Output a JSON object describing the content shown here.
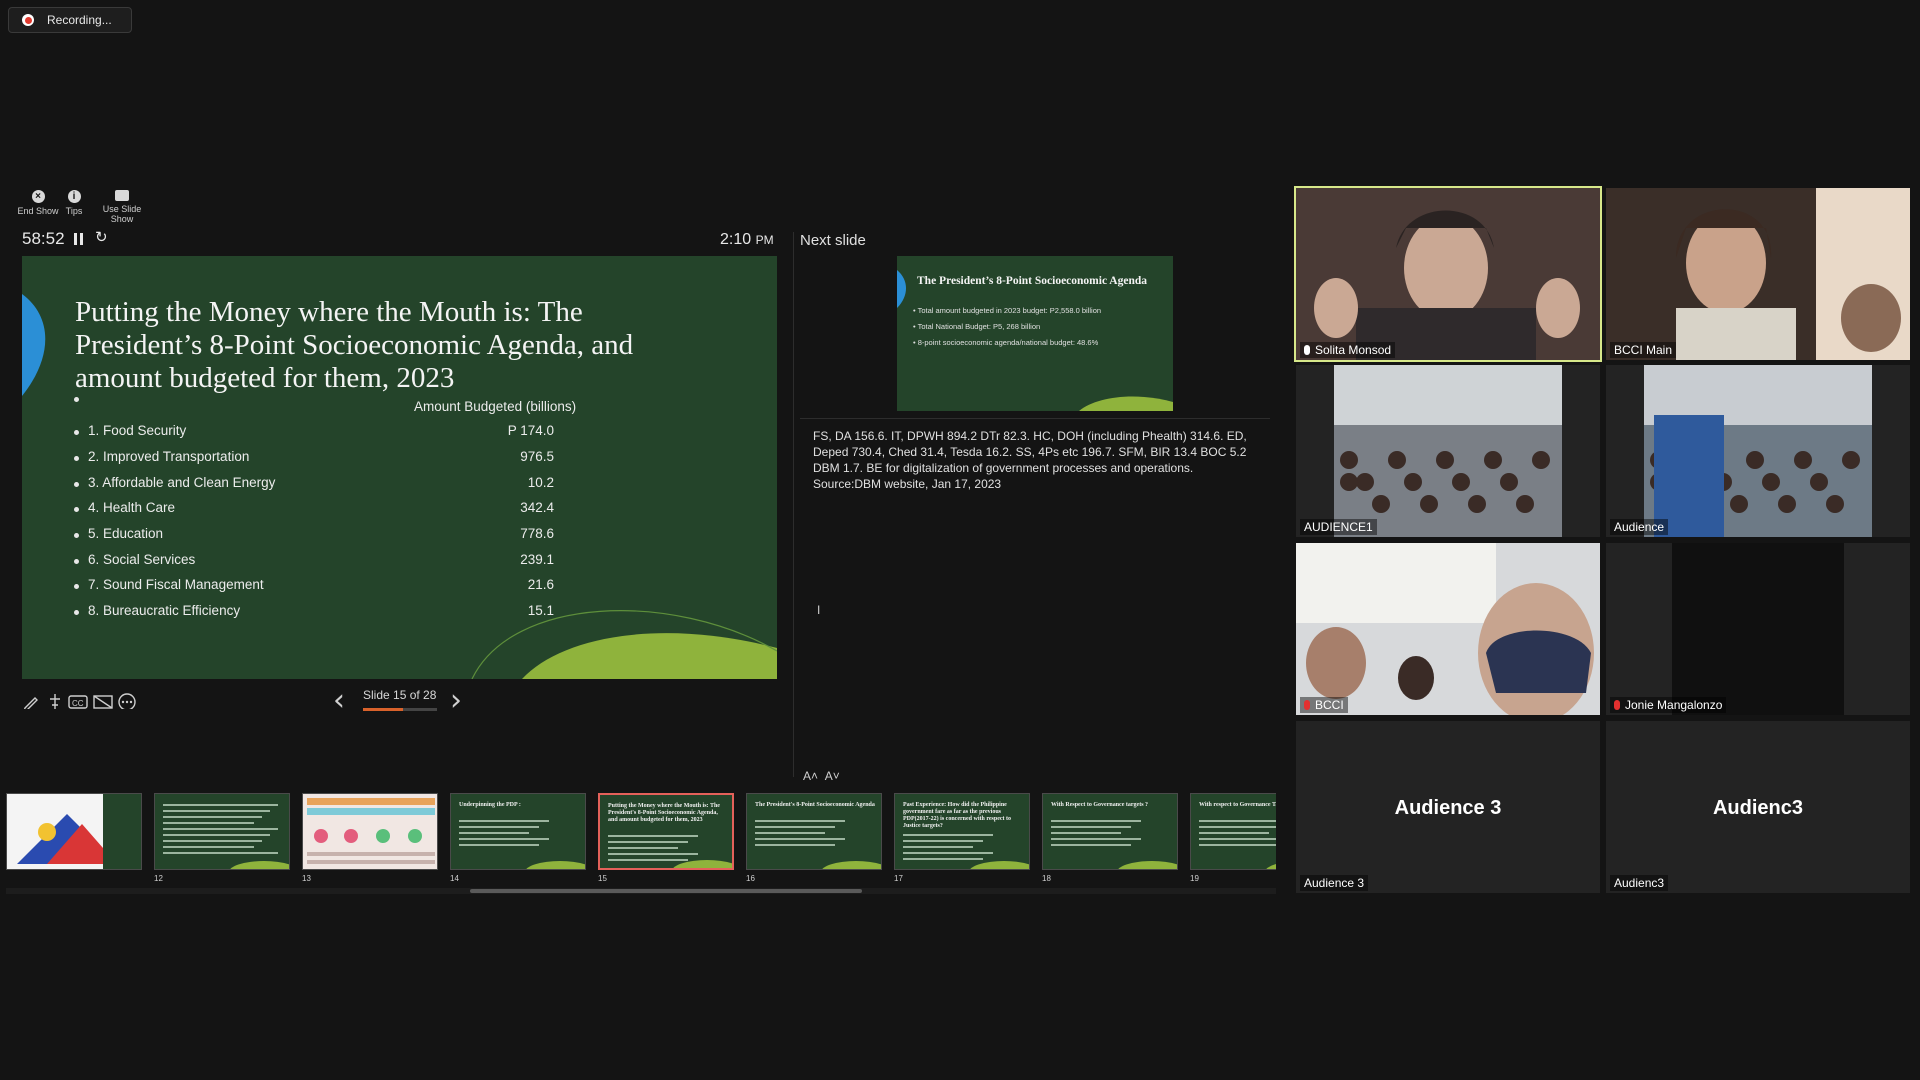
{
  "recording": {
    "label": "Recording..."
  },
  "toolbar": {
    "end_show": "End Show",
    "tips": "Tips",
    "use_slide_show": "Use Slide Show"
  },
  "presenter": {
    "timer": "58:52",
    "clock_time": "2:10",
    "clock_ampm": "PM",
    "next_slide_label": "Next slide",
    "slide_counter": "Slide 15 of 28",
    "progress_fraction": 0.536
  },
  "current_slide": {
    "title": "Putting the Money where the Mouth is:  The President’s 8-Point Socioeconomic Agenda, and amount budgeted for them, 2023",
    "column_header": "Amount Budgeted  (billions)",
    "items": [
      {
        "label": "1. Food Security",
        "value": "P 174.0"
      },
      {
        "label": "2. Improved Transportation",
        "value": "976.5"
      },
      {
        "label": "3. Affordable and Clean Energy",
        "value": "10.2"
      },
      {
        "label": "4. Health Care",
        "value": "342.4"
      },
      {
        "label": "5. Education",
        "value": "778.6"
      },
      {
        "label": "6. Social Services",
        "value": "239.1"
      },
      {
        "label": "7. Sound Fiscal Management",
        "value": "21.6"
      },
      {
        "label": "8. Bureaucratic Efficiency",
        "value": "15.1"
      }
    ]
  },
  "next_slide": {
    "title": "The President’s 8-Point Socioeconomic Agenda",
    "bullets": [
      "Total amount budgeted in 2023 budget:  P2,558.0 billion",
      "Total National Budget:  P5, 268 billion",
      "8-point socioeconomic agenda/national budget:  48.6%"
    ]
  },
  "notes": "FS,  DA 156.6.  IT, DPWH 894.2 DTr 82.3.  HC, DOH (including Phealth) 314.6.  ED, Deped 730.4, Ched 31.4, Tesda 16.2.  SS, 4Ps etc 196.7.  SFM, BIR 13.4  BOC 5.2 DBM 1.7.  BE for digitalization of government processes and operations.   Source:DBM website, Jan 17, 2023",
  "thumbnails": [
    {
      "num": "",
      "title": ""
    },
    {
      "num": "12",
      "title": ""
    },
    {
      "num": "13",
      "title": ""
    },
    {
      "num": "14",
      "title": "Underpinning the PDP :"
    },
    {
      "num": "15",
      "title": "Putting the Money where the Mouth is: The President's 8-Point Socioeconomic Agenda, and amount budgeted for them, 2023",
      "selected": true
    },
    {
      "num": "16",
      "title": "The President's 8-Point Socioeconomic Agenda"
    },
    {
      "num": "17",
      "title": "Past Experience: How did the Philippine government fare as far as the previous PDP(2017-22) is concerned with respect to Justice targets?"
    },
    {
      "num": "18",
      "title": "With Respect to Governance targets ?"
    },
    {
      "num": "19",
      "title": "With respect to Governance Targets?"
    }
  ],
  "participants": [
    {
      "name": "Solita Monsod",
      "speaking": true
    },
    {
      "name": "BCCI Main"
    },
    {
      "name": "AUDIENCE1"
    },
    {
      "name": "Audience"
    },
    {
      "name": "BCCI",
      "muted": true
    },
    {
      "name": "Jonie Mangalonzo",
      "muted": true
    },
    {
      "name": "Audience 3",
      "display": "Audience 3"
    },
    {
      "name": "Audienc3",
      "display": "Audienc3"
    }
  ],
  "colors": {
    "slide_bg": "#24442a",
    "accent_arc": "#8fb33c",
    "slide_left_arc": "#2b8fd6",
    "speaking_border": "#d7e88a",
    "selected_thumb": "#e4615a"
  }
}
